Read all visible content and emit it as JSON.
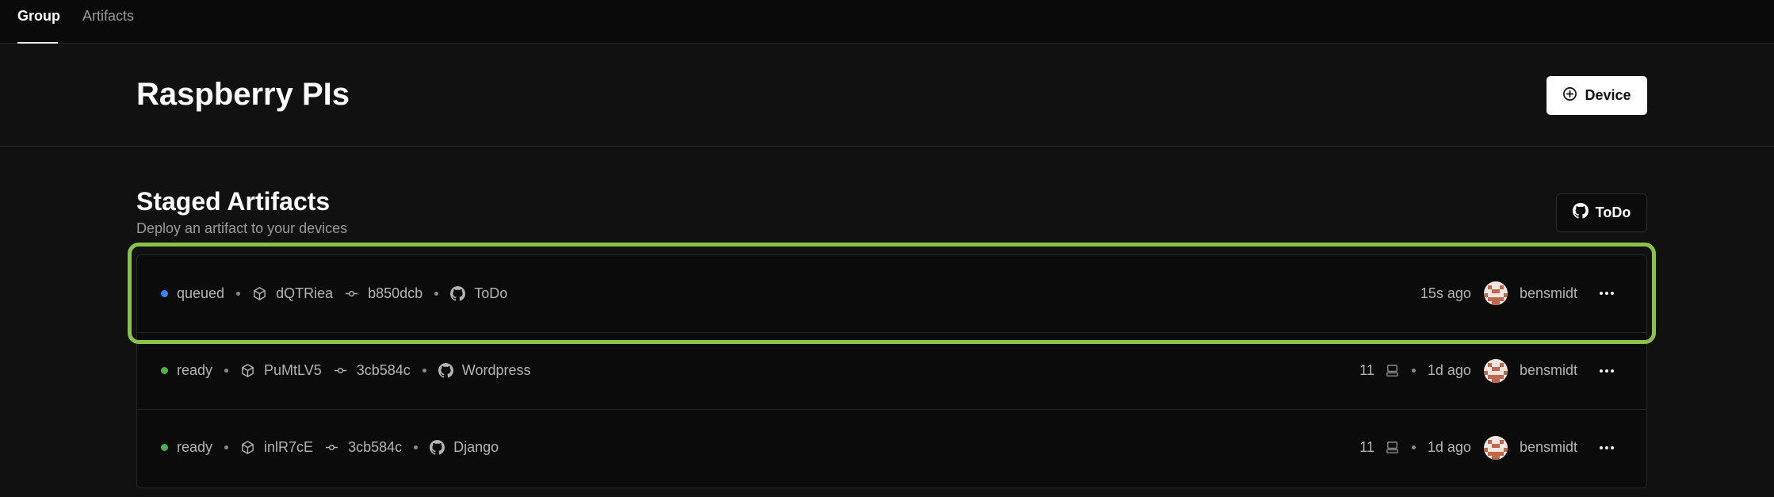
{
  "tabs": [
    {
      "label": "Group",
      "active": true
    },
    {
      "label": "Artifacts",
      "active": false
    }
  ],
  "header": {
    "title": "Raspberry PIs",
    "device_button": {
      "label": "Device",
      "icon": "plus-circle-icon"
    }
  },
  "staged": {
    "title": "Staged Artifacts",
    "subtitle": "Deploy an artifact to your devices",
    "repo_button": {
      "label": "ToDo",
      "icon": "github-icon"
    }
  },
  "artifacts": [
    {
      "status": "queued",
      "status_color": "#3b82f6",
      "id": "dQTRiea",
      "commit": "b850dcb",
      "repo": "ToDo",
      "device_count": "",
      "time": "15s ago",
      "user": "bensmidt",
      "highlighted": true
    },
    {
      "status": "ready",
      "status_color": "#4caf50",
      "id": "PuMtLV5",
      "commit": "3cb584c",
      "repo": "Wordpress",
      "device_count": "11",
      "time": "1d ago",
      "user": "bensmidt",
      "highlighted": false
    },
    {
      "status": "ready",
      "status_color": "#4caf50",
      "id": "inlR7cE",
      "commit": "3cb584c",
      "repo": "Django",
      "device_count": "11",
      "time": "1d ago",
      "user": "bensmidt",
      "highlighted": false
    }
  ],
  "colors": {
    "highlight": "#8bc34a",
    "avatar": "#c0674e"
  }
}
